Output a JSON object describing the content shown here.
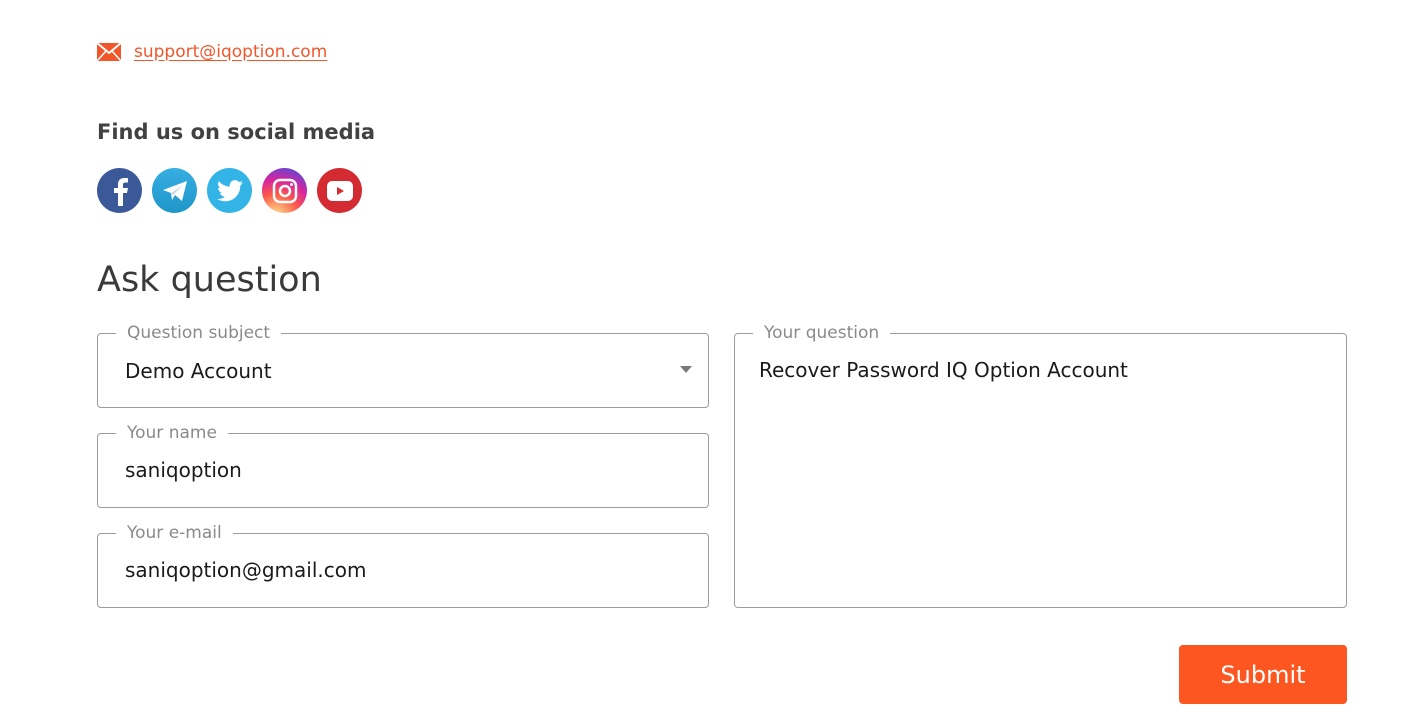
{
  "contact": {
    "email": "support@iqoption.com",
    "icon": "mail-icon"
  },
  "social": {
    "title": "Find us on social media",
    "items": [
      {
        "name": "facebook",
        "icon": "facebook-icon",
        "color": "#3b5998"
      },
      {
        "name": "telegram",
        "icon": "telegram-icon",
        "color": "#2ca5e0"
      },
      {
        "name": "twitter",
        "icon": "twitter-icon",
        "color": "#33b4e6"
      },
      {
        "name": "instagram",
        "icon": "instagram-icon",
        "color": "#c13584"
      },
      {
        "name": "youtube",
        "icon": "youtube-icon",
        "color": "#d42a31"
      }
    ]
  },
  "form": {
    "title": "Ask question",
    "subject": {
      "label": "Question subject",
      "value": "Demo Account"
    },
    "name": {
      "label": "Your name",
      "value": "saniqoption"
    },
    "email": {
      "label": "Your e-mail",
      "value": "saniqoption@gmail.com"
    },
    "question": {
      "label": "Your question",
      "value": "Recover Password IQ Option Account"
    },
    "submit_label": "Submit"
  },
  "colors": {
    "accent": "#fd5621",
    "link": "#f2572b"
  }
}
